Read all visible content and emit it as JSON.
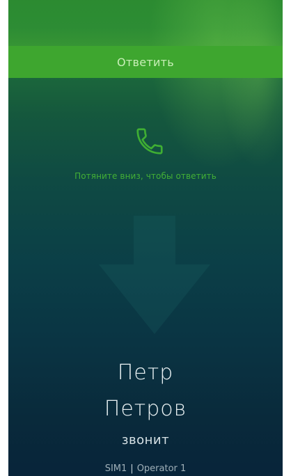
{
  "call": {
    "answer_label": "Ответить",
    "hint": "Потяните вниз, чтобы ответить",
    "caller_first_name": "Петр",
    "caller_last_name": "Петров",
    "status": "звонит",
    "sim": "SIM1",
    "separator": "|",
    "operator": "Operator 1"
  },
  "icons": {
    "answer": "phone-icon",
    "drag_hint": "down-arrow-shape"
  },
  "colors": {
    "accent": "#3ea62f",
    "hint_text": "#43b035",
    "caller_text": "#e9f1f3",
    "background_top": "#2f8e35",
    "background_bottom": "#08243a"
  }
}
